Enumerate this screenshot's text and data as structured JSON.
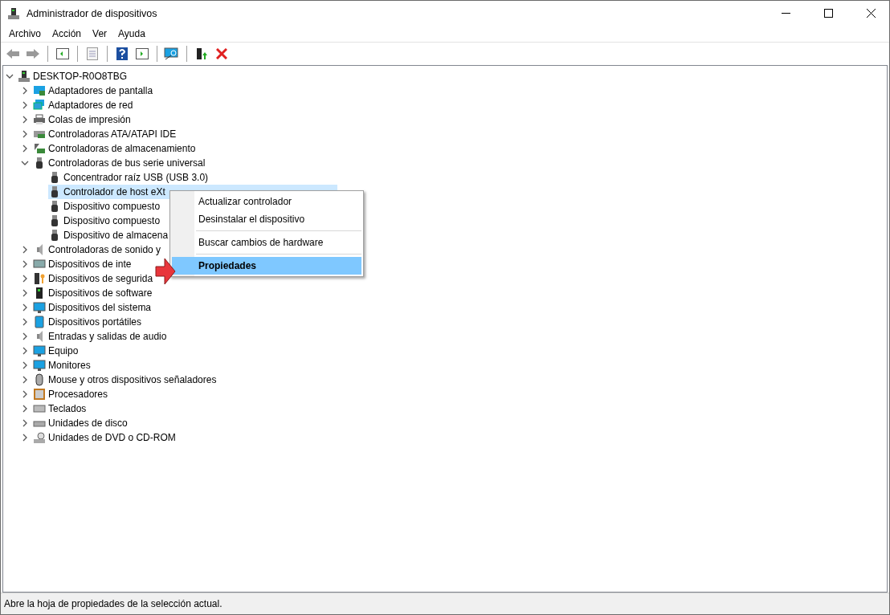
{
  "window": {
    "title": "Administrador de dispositivos"
  },
  "menu_bar": [
    "Archivo",
    "Acción",
    "Ver",
    "Ayuda"
  ],
  "tree": {
    "label": "DESKTOP-R0O8TBG",
    "expanded": true,
    "children": [
      {
        "label": "Adaptadores de pantalla",
        "expanded": false
      },
      {
        "label": "Adaptadores de red",
        "expanded": false
      },
      {
        "label": "Colas de impresión",
        "expanded": false
      },
      {
        "label": "Controladoras ATA/ATAPI IDE",
        "expanded": false
      },
      {
        "label": "Controladoras de almacenamiento",
        "expanded": false
      },
      {
        "label": "Controladoras de bus serie universal",
        "expanded": true,
        "children": [
          {
            "label": "Concentrador raíz USB (USB 3.0)",
            "selected": false
          },
          {
            "label": "Controlador de host eXt",
            "selected": true
          },
          {
            "label": "Dispositivo compuesto",
            "selected": false
          },
          {
            "label": "Dispositivo compuesto",
            "selected": false
          },
          {
            "label": "Dispositivo de almacena",
            "selected": false
          }
        ]
      },
      {
        "label": "Controladoras de sonido y",
        "expanded": false
      },
      {
        "label": "Dispositivos de inte",
        "expanded": false
      },
      {
        "label": "Dispositivos de segurida",
        "expanded": false
      },
      {
        "label": "Dispositivos de software",
        "expanded": false
      },
      {
        "label": "Dispositivos del sistema",
        "expanded": false
      },
      {
        "label": "Dispositivos portátiles",
        "expanded": false
      },
      {
        "label": "Entradas y salidas de audio",
        "expanded": false
      },
      {
        "label": "Equipo",
        "expanded": false
      },
      {
        "label": "Monitores",
        "expanded": false
      },
      {
        "label": "Mouse y otros dispositivos señaladores",
        "expanded": false
      },
      {
        "label": "Procesadores",
        "expanded": false
      },
      {
        "label": "Teclados",
        "expanded": false
      },
      {
        "label": "Unidades de disco",
        "expanded": false
      },
      {
        "label": "Unidades de DVD o CD-ROM",
        "expanded": false
      }
    ]
  },
  "context_menu": {
    "items": [
      {
        "kind": "item",
        "label": "Actualizar controlador",
        "selected": false,
        "bold": false
      },
      {
        "kind": "item",
        "label": "Desinstalar el dispositivo",
        "selected": false,
        "bold": false
      },
      {
        "kind": "separator"
      },
      {
        "kind": "item",
        "label": "Buscar cambios de hardware",
        "selected": false,
        "bold": false
      },
      {
        "kind": "separator"
      },
      {
        "kind": "item",
        "label": "Propiedades",
        "selected": true,
        "bold": true
      }
    ]
  },
  "status_bar": "Abre la hoja de propiedades de la selección actual."
}
